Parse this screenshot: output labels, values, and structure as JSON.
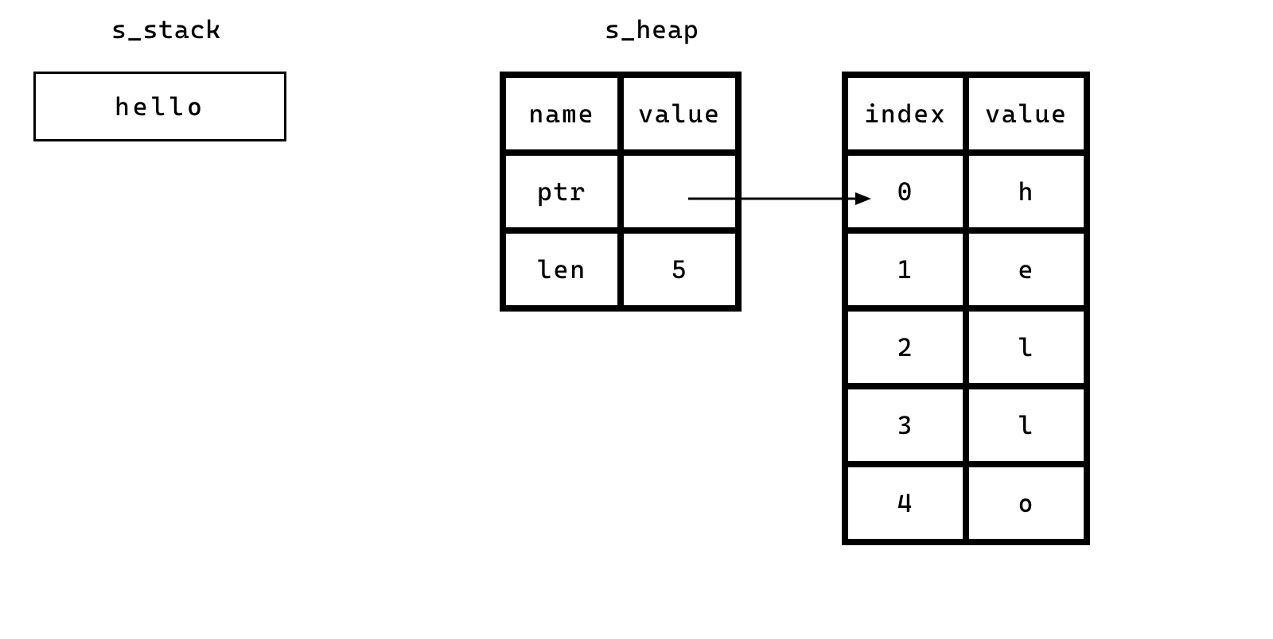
{
  "labels": {
    "stack": "s_stack",
    "heap": "s_heap"
  },
  "stack_value": "hello",
  "heap_struct": {
    "headers": {
      "name": "name",
      "value": "value"
    },
    "rows": [
      {
        "name": "ptr",
        "value": ""
      },
      {
        "name": "len",
        "value": "5"
      }
    ]
  },
  "heap_buffer": {
    "headers": {
      "index": "index",
      "value": "value"
    },
    "rows": [
      {
        "index": "0",
        "value": "h"
      },
      {
        "index": "1",
        "value": "e"
      },
      {
        "index": "2",
        "value": "l"
      },
      {
        "index": "3",
        "value": "l"
      },
      {
        "index": "4",
        "value": "o"
      }
    ]
  }
}
